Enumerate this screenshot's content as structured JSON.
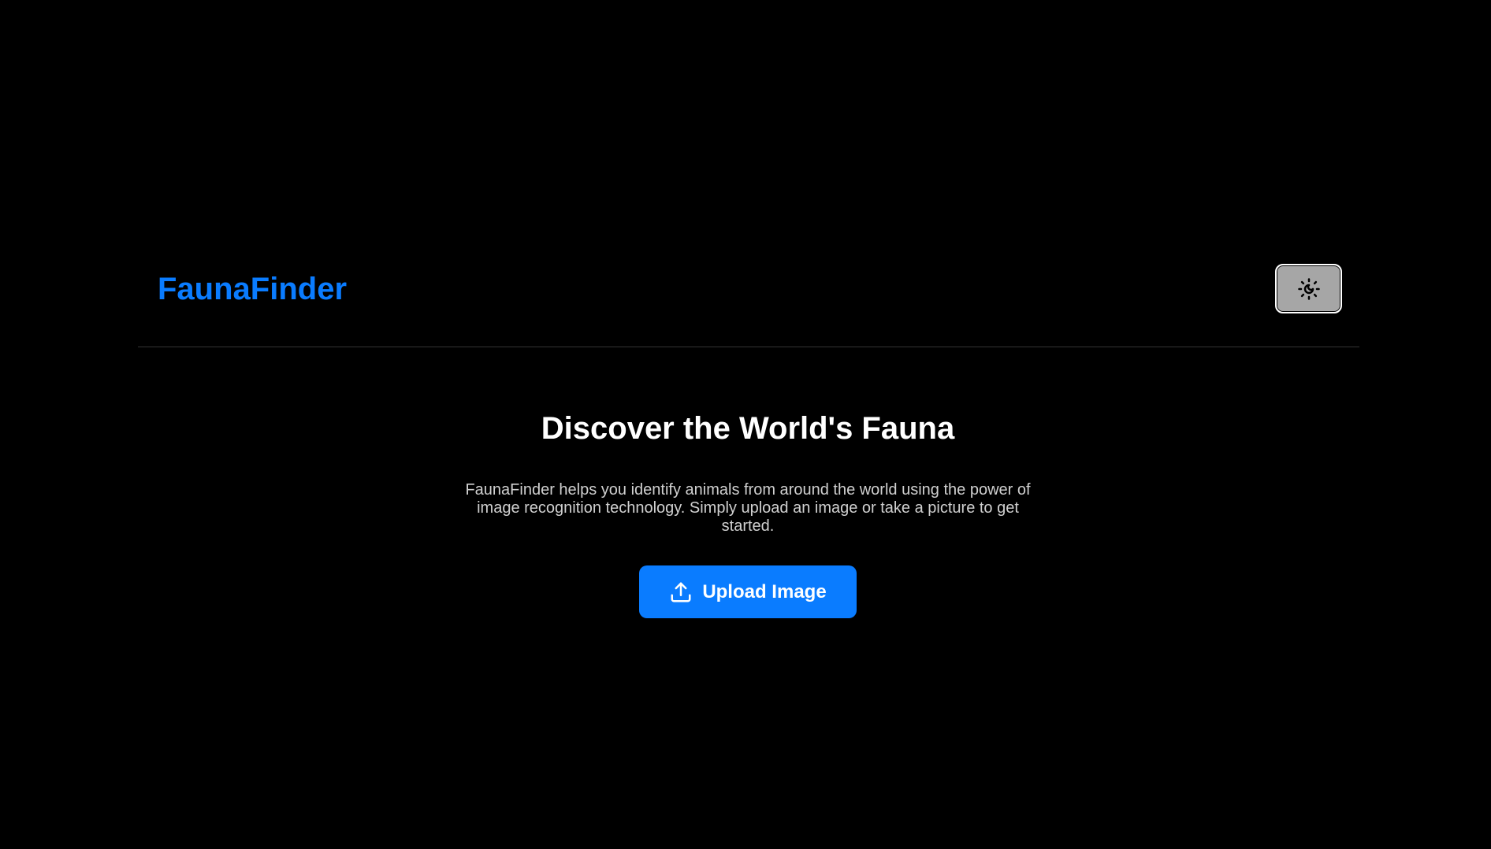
{
  "header": {
    "brand": "FaunaFinder",
    "theme_toggle_icon": "theme-toggle-icon"
  },
  "hero": {
    "title": "Discover the World's Fauna",
    "description": "FaunaFinder helps you identify animals from around the world using the power of image recognition technology. Simply upload an image or take a picture to get started.",
    "upload_label": "Upload Image",
    "upload_icon": "upload-icon"
  },
  "colors": {
    "background": "#000000",
    "accent": "#0a7cff",
    "toggle_background": "#a6a6a6"
  }
}
